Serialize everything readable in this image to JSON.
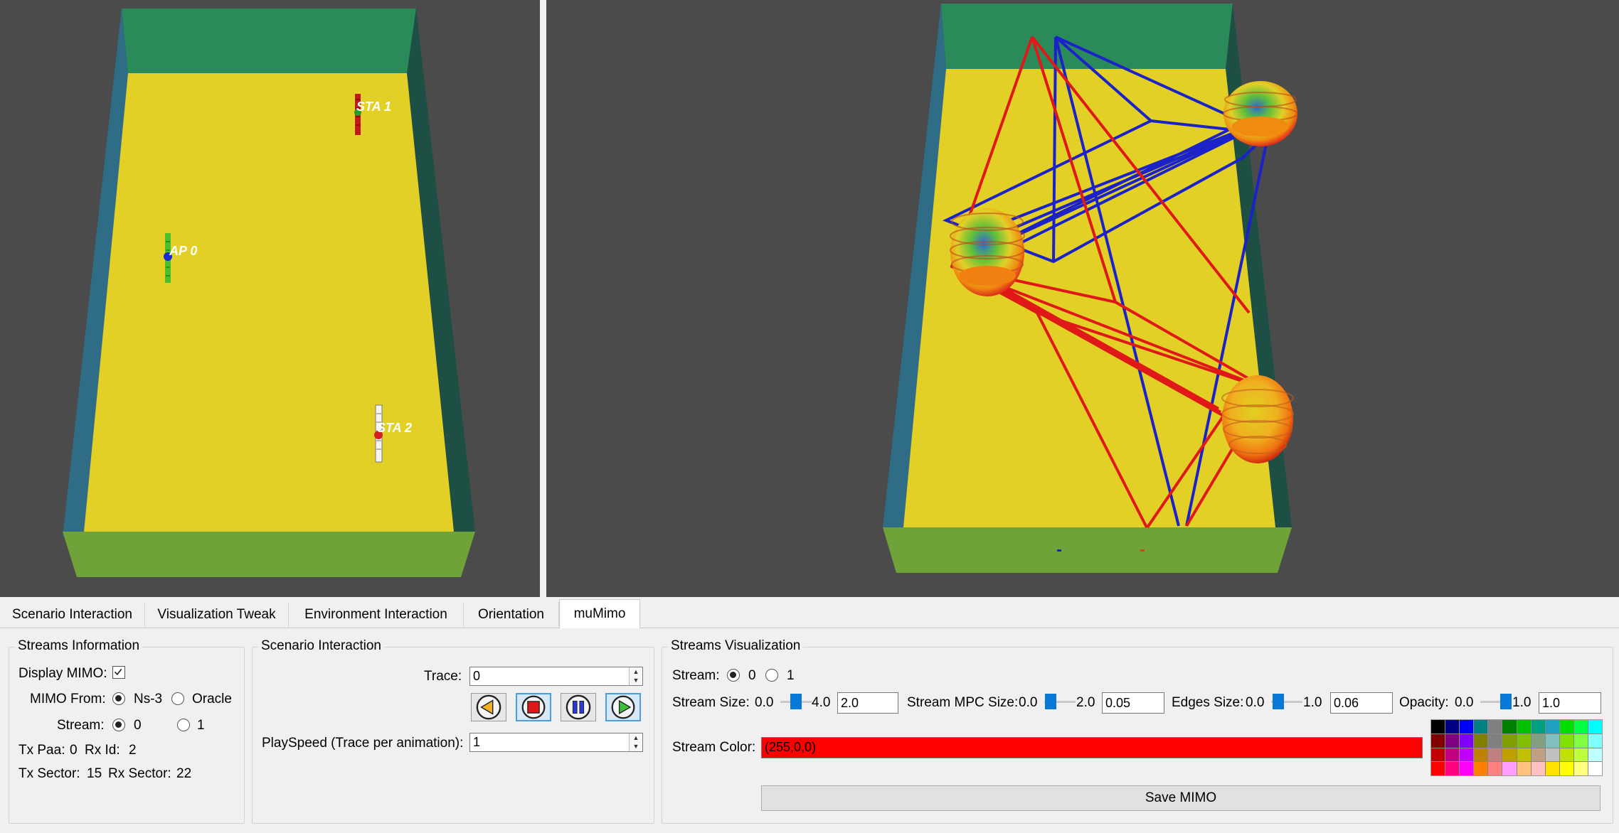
{
  "viewports": {
    "left": {
      "labels": [
        "STA 1",
        "AP 0",
        "STA 2"
      ]
    },
    "right": {}
  },
  "tabs": [
    {
      "label": "Scenario Interaction",
      "active": false
    },
    {
      "label": "Visualization Tweak",
      "active": false
    },
    {
      "label": "Environment Interaction",
      "active": false
    },
    {
      "label": "Orientation",
      "active": false
    },
    {
      "label": "muMimo",
      "active": true
    }
  ],
  "streams_info": {
    "title": "Streams Information",
    "display_mimo_label": "Display MIMO:",
    "display_mimo_checked": true,
    "mimo_from_label": "MIMO From:",
    "mimo_from_options": [
      "Ns-3",
      "Oracle"
    ],
    "mimo_from_selected": "Ns-3",
    "stream_label": "Stream:",
    "stream_options": [
      "0",
      "1"
    ],
    "stream_selected": "0",
    "tx_paa_label": "Tx Paa:",
    "tx_paa_value": "0",
    "rx_id_label": "Rx Id:",
    "rx_id_value": "2",
    "tx_sector_label": "Tx Sector:",
    "tx_sector_value": "15",
    "rx_sector_label": "Rx Sector:",
    "rx_sector_value": "22"
  },
  "scenario": {
    "title": "Scenario Interaction",
    "trace_label": "Trace:",
    "trace_value": "0",
    "buttons": [
      "rewind",
      "stop",
      "pause",
      "play"
    ],
    "playspeed_label": "PlaySpeed (Trace per animation):",
    "playspeed_value": "1"
  },
  "streams_vis": {
    "title": "Streams Visualization",
    "stream_label": "Stream:",
    "stream_options": [
      "0",
      "1"
    ],
    "stream_selected": "0",
    "stream_size": {
      "label": "Stream Size:",
      "min": "0.0",
      "max": "4.0",
      "value": "2.0",
      "level": 0.5
    },
    "mpc_size": {
      "label": "Stream MPC Size:",
      "min": "0.0",
      "max": "2.0",
      "value": "0.05",
      "level": 0.025
    },
    "edges_size": {
      "label": "Edges Size:",
      "min": "0.0",
      "max": "1.0",
      "value": "0.06",
      "level": 0.06
    },
    "opacity": {
      "label": "Opacity:",
      "min": "0.0",
      "max": "1.0",
      "value": "1.0",
      "level": 1.0
    },
    "color_label": "Stream Color:",
    "color_value": "(255,0,0)",
    "color_hex": "#ff0000",
    "palette": [
      "#000000",
      "#000080",
      "#0000ff",
      "#008080",
      "#808080",
      "#008000",
      "#00c000",
      "#00a080",
      "#20a0c0",
      "#00e000",
      "#00ff40",
      "#00ffff",
      "#800000",
      "#800080",
      "#8000ff",
      "#808000",
      "#808080",
      "#80a000",
      "#80c000",
      "#80a080",
      "#80c0c0",
      "#80e000",
      "#80ff40",
      "#80ffff",
      "#c00000",
      "#c00080",
      "#c000ff",
      "#c08000",
      "#c08080",
      "#c0a000",
      "#c0c000",
      "#c0a080",
      "#c0c0c0",
      "#c0e000",
      "#c0ff40",
      "#c0ffff",
      "#ff0000",
      "#ff0080",
      "#ff00ff",
      "#ff8000",
      "#ff8080",
      "#ffa0ff",
      "#ffc080",
      "#ffc0c0",
      "#ffe000",
      "#ffff00",
      "#ffff80",
      "#ffffff"
    ],
    "save_label": "Save MIMO"
  }
}
